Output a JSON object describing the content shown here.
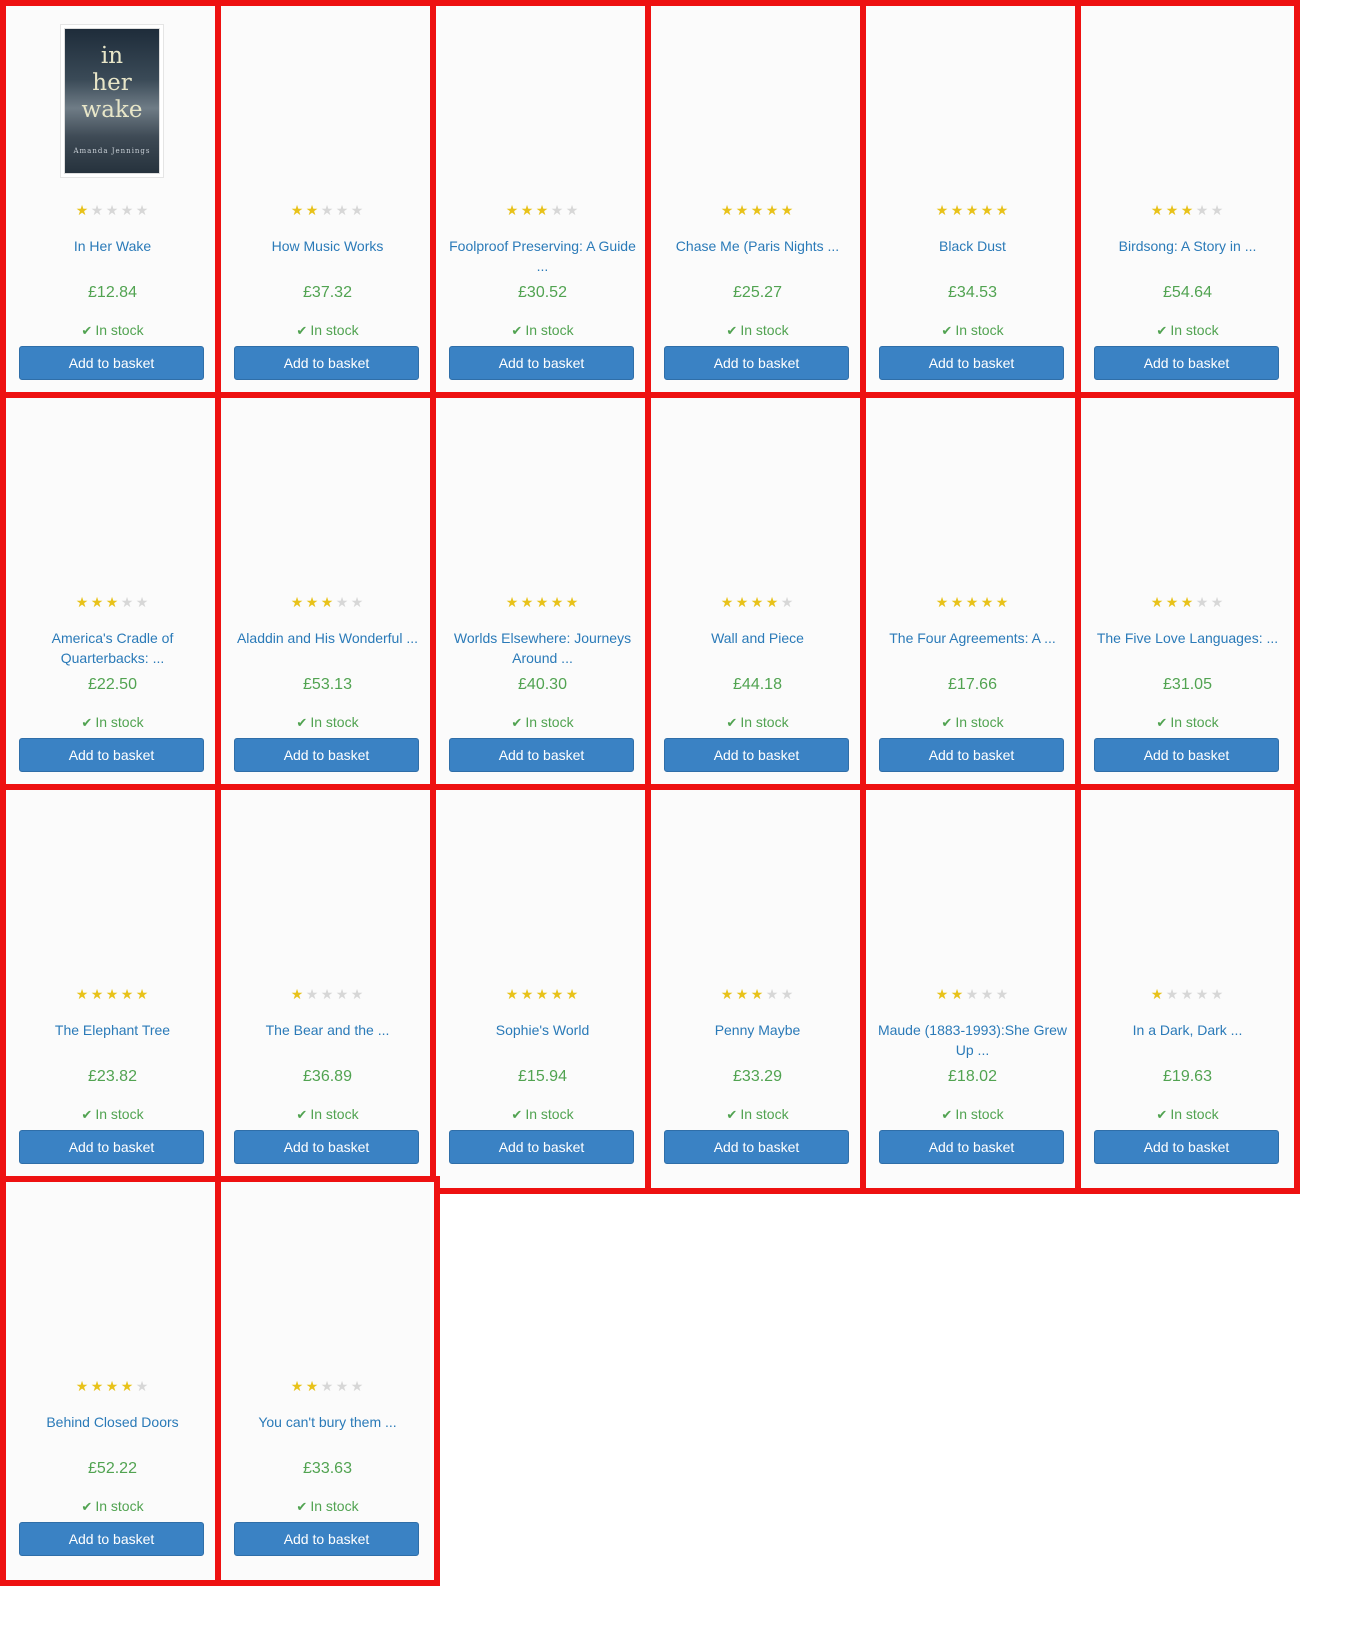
{
  "colors": {
    "card_border": "#ee1111",
    "link": "#2a7ab8",
    "price": "#51a351",
    "button": "#3a82c4",
    "star_on": "#e8c21a",
    "star_off": "#d7d7d7"
  },
  "common": {
    "stock_label": "In stock",
    "button_label": "Add to basket",
    "check_icon": "check-icon",
    "star_icon": "star-icon"
  },
  "products": [
    {
      "title": "In Her Wake",
      "price": "£12.84",
      "rating": 1,
      "has_image": true,
      "cover_title": [
        "in",
        "her",
        "wake"
      ],
      "cover_author": "Amanda Jennings"
    },
    {
      "title": "How Music Works",
      "price": "£37.32",
      "rating": 2
    },
    {
      "title": "Foolproof Preserving: A Guide ...",
      "price": "£30.52",
      "rating": 3
    },
    {
      "title": "Chase Me (Paris Nights ...",
      "price": "£25.27",
      "rating": 5
    },
    {
      "title": "Black Dust",
      "price": "£34.53",
      "rating": 5
    },
    {
      "title": "Birdsong: A Story in ...",
      "price": "£54.64",
      "rating": 3
    },
    {
      "title": "America's Cradle of Quarterbacks: ...",
      "price": "£22.50",
      "rating": 3
    },
    {
      "title": "Aladdin and His Wonderful ...",
      "price": "£53.13",
      "rating": 3
    },
    {
      "title": "Worlds Elsewhere: Journeys Around ...",
      "price": "£40.30",
      "rating": 5
    },
    {
      "title": "Wall and Piece",
      "price": "£44.18",
      "rating": 4
    },
    {
      "title": "The Four Agreements: A ...",
      "price": "£17.66",
      "rating": 5
    },
    {
      "title": "The Five Love Languages: ...",
      "price": "£31.05",
      "rating": 3
    },
    {
      "title": "The Elephant Tree",
      "price": "£23.82",
      "rating": 5
    },
    {
      "title": "The Bear and the ...",
      "price": "£36.89",
      "rating": 1
    },
    {
      "title": "Sophie's World",
      "price": "£15.94",
      "rating": 5
    },
    {
      "title": "Penny Maybe",
      "price": "£33.29",
      "rating": 3
    },
    {
      "title": "Maude (1883-1993):She Grew Up ...",
      "price": "£18.02",
      "rating": 2
    },
    {
      "title": "In a Dark, Dark ...",
      "price": "£19.63",
      "rating": 1
    },
    {
      "title": "Behind Closed Doors",
      "price": "£52.22",
      "rating": 4
    },
    {
      "title": "You can't bury them ...",
      "price": "£33.63",
      "rating": 2
    }
  ]
}
